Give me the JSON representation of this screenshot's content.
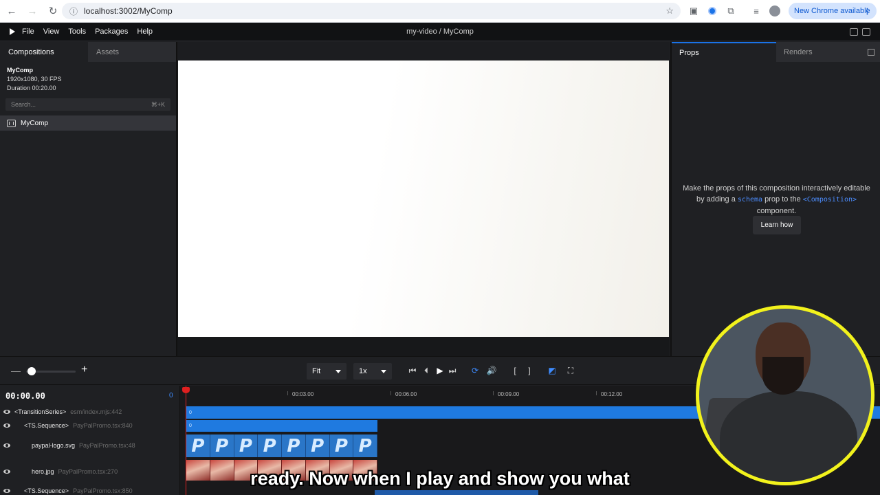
{
  "browser": {
    "url": "localhost:3002/MyComp",
    "new_chrome": "New Chrome available"
  },
  "menubar": {
    "items": [
      "File",
      "View",
      "Tools",
      "Packages",
      "Help"
    ],
    "title": "my-video / MyComp"
  },
  "left_panel": {
    "tabs": [
      "Compositions",
      "Assets"
    ],
    "composition": {
      "name": "MyComp",
      "resolution": "1920x1080, 30 FPS",
      "duration": "Duration 00:20.00"
    },
    "search_placeholder": "Search...",
    "search_shortcut": "⌘+K",
    "items": [
      {
        "label": "MyComp"
      }
    ]
  },
  "right_panel": {
    "tabs": [
      "Props",
      "Renders"
    ],
    "message_pre": "Make the props of this composition interactively editable by adding a",
    "message_code1": "schema",
    "message_mid": "prop to the",
    "message_code2": "<Composition>",
    "message_post": "component.",
    "learn_button": "Learn how"
  },
  "controls": {
    "fit": "Fit",
    "speed": "1x",
    "zoom_level": 0.05
  },
  "timeline": {
    "timecode": "00:00.00",
    "frame": "0",
    "ruler": [
      "00:03.00",
      "00:06.00",
      "00:09.00",
      "00:12.00"
    ],
    "tracks": [
      {
        "name": "<TransitionSeries>",
        "src": "esm/index.mjs:442",
        "bar_label": "0"
      },
      {
        "name": "<TS.Sequence>",
        "src": "PayPalPromo.tsx:840",
        "bar_label": "0"
      },
      {
        "name": "paypal-logo.svg",
        "src": "PayPalPromo.tsx:48"
      },
      {
        "name": "hero.jpg",
        "src": "PayPalPromo.tsx:270"
      },
      {
        "name": "<TS.Sequence>",
        "src": "PayPalPromo.tsx:850"
      }
    ]
  },
  "subtitle": "ready. Now when I play and show you what",
  "colors": {
    "accent": "#1f7ae0",
    "playhead": "#e02020",
    "webcam_ring": "#f2f21c"
  }
}
